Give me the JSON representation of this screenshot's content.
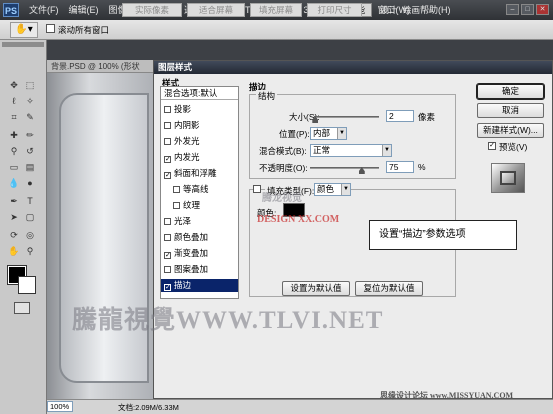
{
  "app": {
    "logo": "PS",
    "menu": [
      "文件(F)",
      "编辑(E)",
      "图像(I)",
      "图层(L)",
      "选择(S)",
      "滤镜(T)",
      "分析(A)",
      "3D(D)",
      "视图(V)",
      "窗口(W)",
      "帮助(H)"
    ],
    "workspaces": {
      "active": "基本功能",
      "design": "设计",
      "painting": "绘画"
    },
    "window_controls": [
      "–",
      "□",
      "✕"
    ]
  },
  "options_bar": {
    "scroll_all_windows": "滚动所有窗口",
    "actual_pixels": "实际像素",
    "fit_screen": "适合屏幕",
    "fill_screen": "填充屏幕",
    "print_size": "打印尺寸"
  },
  "document": {
    "tab_title": "背景.PSD @ 100% (形状",
    "zoom": "100%",
    "doc_info": "文档:2.09M/6.33M"
  },
  "dialog": {
    "title": "图层样式",
    "styles_header": "样式",
    "styles": [
      {
        "label": "混合选项:默认",
        "checkbox": false,
        "checked": false,
        "indent": false
      },
      {
        "label": "投影",
        "checkbox": true,
        "checked": false,
        "indent": false
      },
      {
        "label": "内阴影",
        "checkbox": true,
        "checked": false,
        "indent": false
      },
      {
        "label": "外发光",
        "checkbox": true,
        "checked": false,
        "indent": false
      },
      {
        "label": "内发光",
        "checkbox": true,
        "checked": true,
        "indent": false
      },
      {
        "label": "斜面和浮雕",
        "checkbox": true,
        "checked": true,
        "indent": false
      },
      {
        "label": "等高线",
        "checkbox": true,
        "checked": false,
        "indent": true
      },
      {
        "label": "纹理",
        "checkbox": true,
        "checked": false,
        "indent": true
      },
      {
        "label": "光泽",
        "checkbox": true,
        "checked": false,
        "indent": false
      },
      {
        "label": "颜色叠加",
        "checkbox": true,
        "checked": false,
        "indent": false
      },
      {
        "label": "渐变叠加",
        "checkbox": true,
        "checked": true,
        "indent": false
      },
      {
        "label": "图案叠加",
        "checkbox": true,
        "checked": false,
        "indent": false
      },
      {
        "label": "描边",
        "checkbox": true,
        "checked": true,
        "indent": false,
        "selected": true
      }
    ],
    "stroke": {
      "section_title": "描边",
      "structure_title": "结构",
      "size_label": "大小(S):",
      "size_value": "2",
      "size_unit": "像素",
      "size_fraction": 0.02,
      "position_label": "位置(P):",
      "position_value": "内部",
      "blend_label": "混合模式(B):",
      "blend_value": "正常",
      "opacity_label": "不透明度(O):",
      "opacity_value": "75",
      "opacity_unit": "%",
      "opacity_fraction": 0.75,
      "fill_type_label": "填充类型(F):",
      "fill_type_value": "颜色",
      "color_label": "颜色:",
      "color_swatch": "#000000"
    },
    "set_default": "设置为默认值",
    "reset_default": "复位为默认值",
    "ok": "确定",
    "cancel": "取消",
    "new_style": "新建样式(W)...",
    "preview": "预览(V)"
  },
  "callout": "设置“描边”参数选项",
  "watermarks": {
    "main": "騰龍視覺WWW.TLVI.NET",
    "mid_top": "腾龙视觉",
    "mid_bottom": "DESIGN XX.COM",
    "footer": "思缘设计论坛 www.MISSYUAN.COM"
  },
  "colors": {
    "accent": "#0a246a",
    "chrome": "#3d4045",
    "callout_bg": "#ffffff"
  }
}
